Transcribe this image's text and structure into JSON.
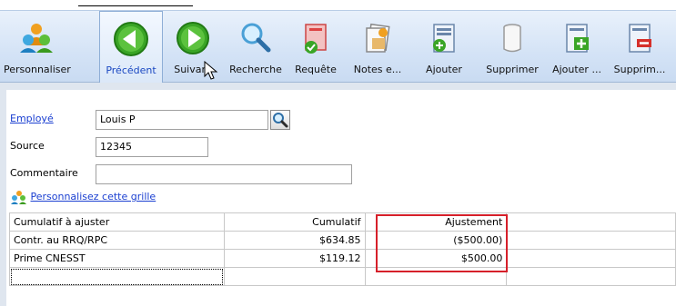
{
  "toolbar": {
    "buttons": [
      {
        "label": "Personnaliser",
        "icon": "customize-people-icon"
      },
      {
        "label": "Précédent",
        "icon": "previous-arrow-icon",
        "selected": true
      },
      {
        "label": "Suivant",
        "icon": "next-arrow-icon"
      },
      {
        "label": "Recherche",
        "icon": "search-magnifier-icon"
      },
      {
        "label": "Requête",
        "icon": "query-document-icon"
      },
      {
        "label": "Notes e...",
        "icon": "notes-icon"
      },
      {
        "label": "Ajouter",
        "icon": "add-record-icon"
      },
      {
        "label": "Supprimer",
        "icon": "delete-cylinder-icon"
      },
      {
        "label": "Ajouter ...",
        "icon": "add-row-icon"
      },
      {
        "label": "Supprim...",
        "icon": "delete-row-icon"
      }
    ]
  },
  "form": {
    "employee_label": "Employé",
    "employee_value": "Louis P",
    "source_label": "Source",
    "source_value": "12345",
    "comment_label": "Commentaire",
    "comment_value": ""
  },
  "grid_link": "Personnalisez cette grille",
  "grid": {
    "headers": [
      "Cumulatif à ajuster",
      "Cumulatif",
      "Ajustement"
    ],
    "rows": [
      [
        "Contr. au RRQ/RPC",
        "$634.85",
        "($500.00)"
      ],
      [
        "Prime CNESST",
        "$119.12",
        "$500.00"
      ],
      [
        "",
        "",
        ""
      ]
    ]
  },
  "colors": {
    "accent": "#1a3fd1",
    "highlight": "#d6202a",
    "toolbar": "#d4e3f6"
  }
}
